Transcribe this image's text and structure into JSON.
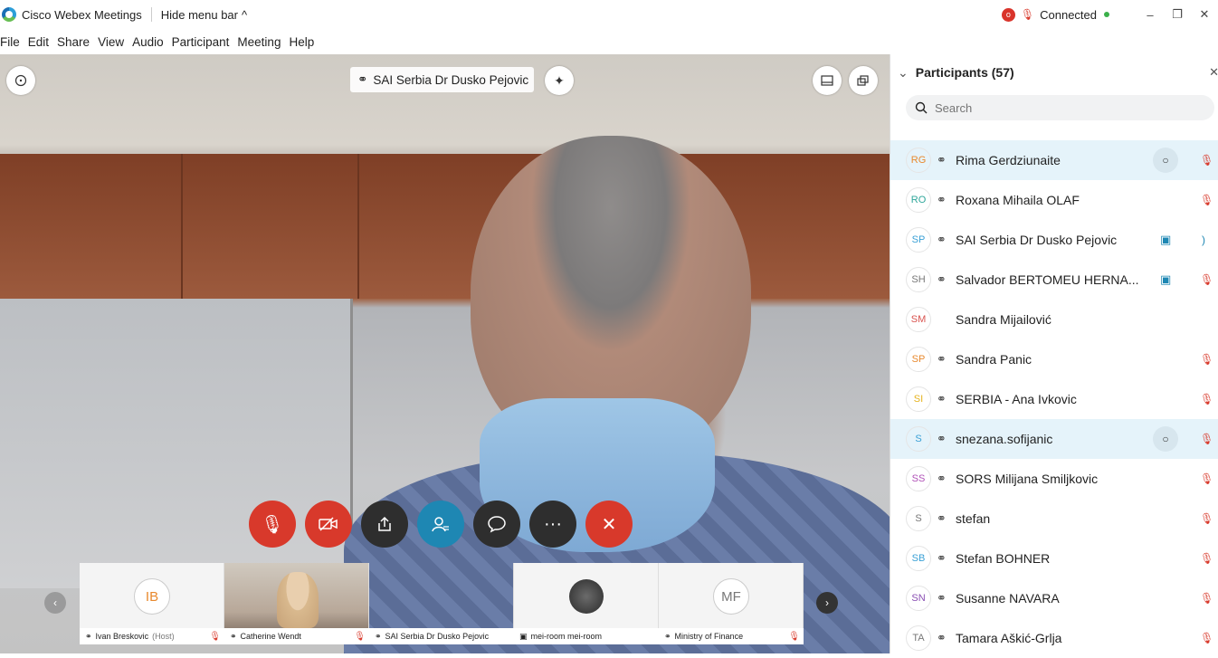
{
  "window": {
    "title": "Cisco Webex Meetings",
    "hide_menu": "Hide menu bar",
    "status": "Connected",
    "rec_label": "o"
  },
  "menu": [
    "File",
    "Edit",
    "Share",
    "View",
    "Audio",
    "Participant",
    "Meeting",
    "Help"
  ],
  "video": {
    "speaker_name": "SAI Serbia Dr Dusko Pejovic"
  },
  "controls": [
    {
      "name": "mute-button",
      "icon": "mic-off-icon"
    },
    {
      "name": "video-button",
      "icon": "camera-off-icon"
    },
    {
      "name": "share-button",
      "icon": "share-icon"
    },
    {
      "name": "participants-button",
      "icon": "participants-icon"
    },
    {
      "name": "chat-button",
      "icon": "chat-icon"
    },
    {
      "name": "more-button",
      "icon": "more-icon"
    },
    {
      "name": "leave-button",
      "icon": "close-icon"
    }
  ],
  "strip": [
    {
      "name": "Ivan Breskovic",
      "suffix": "(Host)",
      "initials": "IB",
      "type": "avatar"
    },
    {
      "name": "Catherine Wendt",
      "suffix": "",
      "initials": "",
      "type": "photo"
    },
    {
      "name": "SAI Serbia Dr Dusko Pejovic",
      "suffix": "",
      "initials": "",
      "type": "video"
    },
    {
      "name": "mei-room mei-room",
      "suffix": "",
      "initials": "",
      "type": "room"
    },
    {
      "name": "Ministry of Finance",
      "suffix": "",
      "initials": "MF",
      "type": "avatar"
    }
  ],
  "participants": {
    "title": "Participants (57)",
    "search_placeholder": "Search",
    "items": [
      {
        "initials": "RG",
        "name": "Rima Gerdziunaite",
        "color": "#e8892e",
        "audio": true,
        "chat": true,
        "cam": false,
        "muted": true,
        "highlight": true
      },
      {
        "initials": "RO",
        "name": "Roxana Mihaila OLAF",
        "color": "#2fa69a",
        "audio": true,
        "chat": false,
        "cam": false,
        "muted": true,
        "highlight": false
      },
      {
        "initials": "SP",
        "name": "SAI Serbia Dr Dusko Pejovic",
        "color": "#3aa0d6",
        "audio": true,
        "chat": false,
        "cam": true,
        "muted": false,
        "highlight": false
      },
      {
        "initials": "SH",
        "name": "Salvador BERTOMEU HERNA...",
        "color": "#777777",
        "audio": true,
        "chat": false,
        "cam": true,
        "muted": true,
        "highlight": false
      },
      {
        "initials": "SM",
        "name": "Sandra Mijailović",
        "color": "#d9534f",
        "audio": false,
        "chat": false,
        "cam": false,
        "muted": false,
        "highlight": false
      },
      {
        "initials": "SP",
        "name": "Sandra Panic",
        "color": "#e8892e",
        "audio": true,
        "chat": false,
        "cam": false,
        "muted": true,
        "highlight": false
      },
      {
        "initials": "SI",
        "name": "SERBIA - Ana Ivkovic",
        "color": "#e6b31e",
        "audio": true,
        "chat": false,
        "cam": false,
        "muted": true,
        "highlight": false
      },
      {
        "initials": "S",
        "name": "snezana.sofijanic",
        "color": "#3aa0d6",
        "audio": true,
        "chat": true,
        "cam": false,
        "muted": true,
        "highlight": true
      },
      {
        "initials": "SS",
        "name": "SORS Milijana Smiljkovic",
        "color": "#b152b8",
        "audio": true,
        "chat": false,
        "cam": false,
        "muted": true,
        "highlight": false
      },
      {
        "initials": "S",
        "name": "stefan",
        "color": "#777777",
        "audio": true,
        "chat": false,
        "cam": false,
        "muted": true,
        "highlight": false
      },
      {
        "initials": "SB",
        "name": "Stefan BOHNER",
        "color": "#3aa0d6",
        "audio": true,
        "chat": false,
        "cam": false,
        "muted": true,
        "highlight": false
      },
      {
        "initials": "SN",
        "name": "Susanne NAVARA",
        "color": "#8a4fb3",
        "audio": true,
        "chat": false,
        "cam": false,
        "muted": true,
        "highlight": false
      },
      {
        "initials": "TA",
        "name": "Tamara Aškić-Grlja",
        "color": "#777777",
        "audio": true,
        "chat": false,
        "cam": false,
        "muted": true,
        "highlight": false
      }
    ]
  }
}
